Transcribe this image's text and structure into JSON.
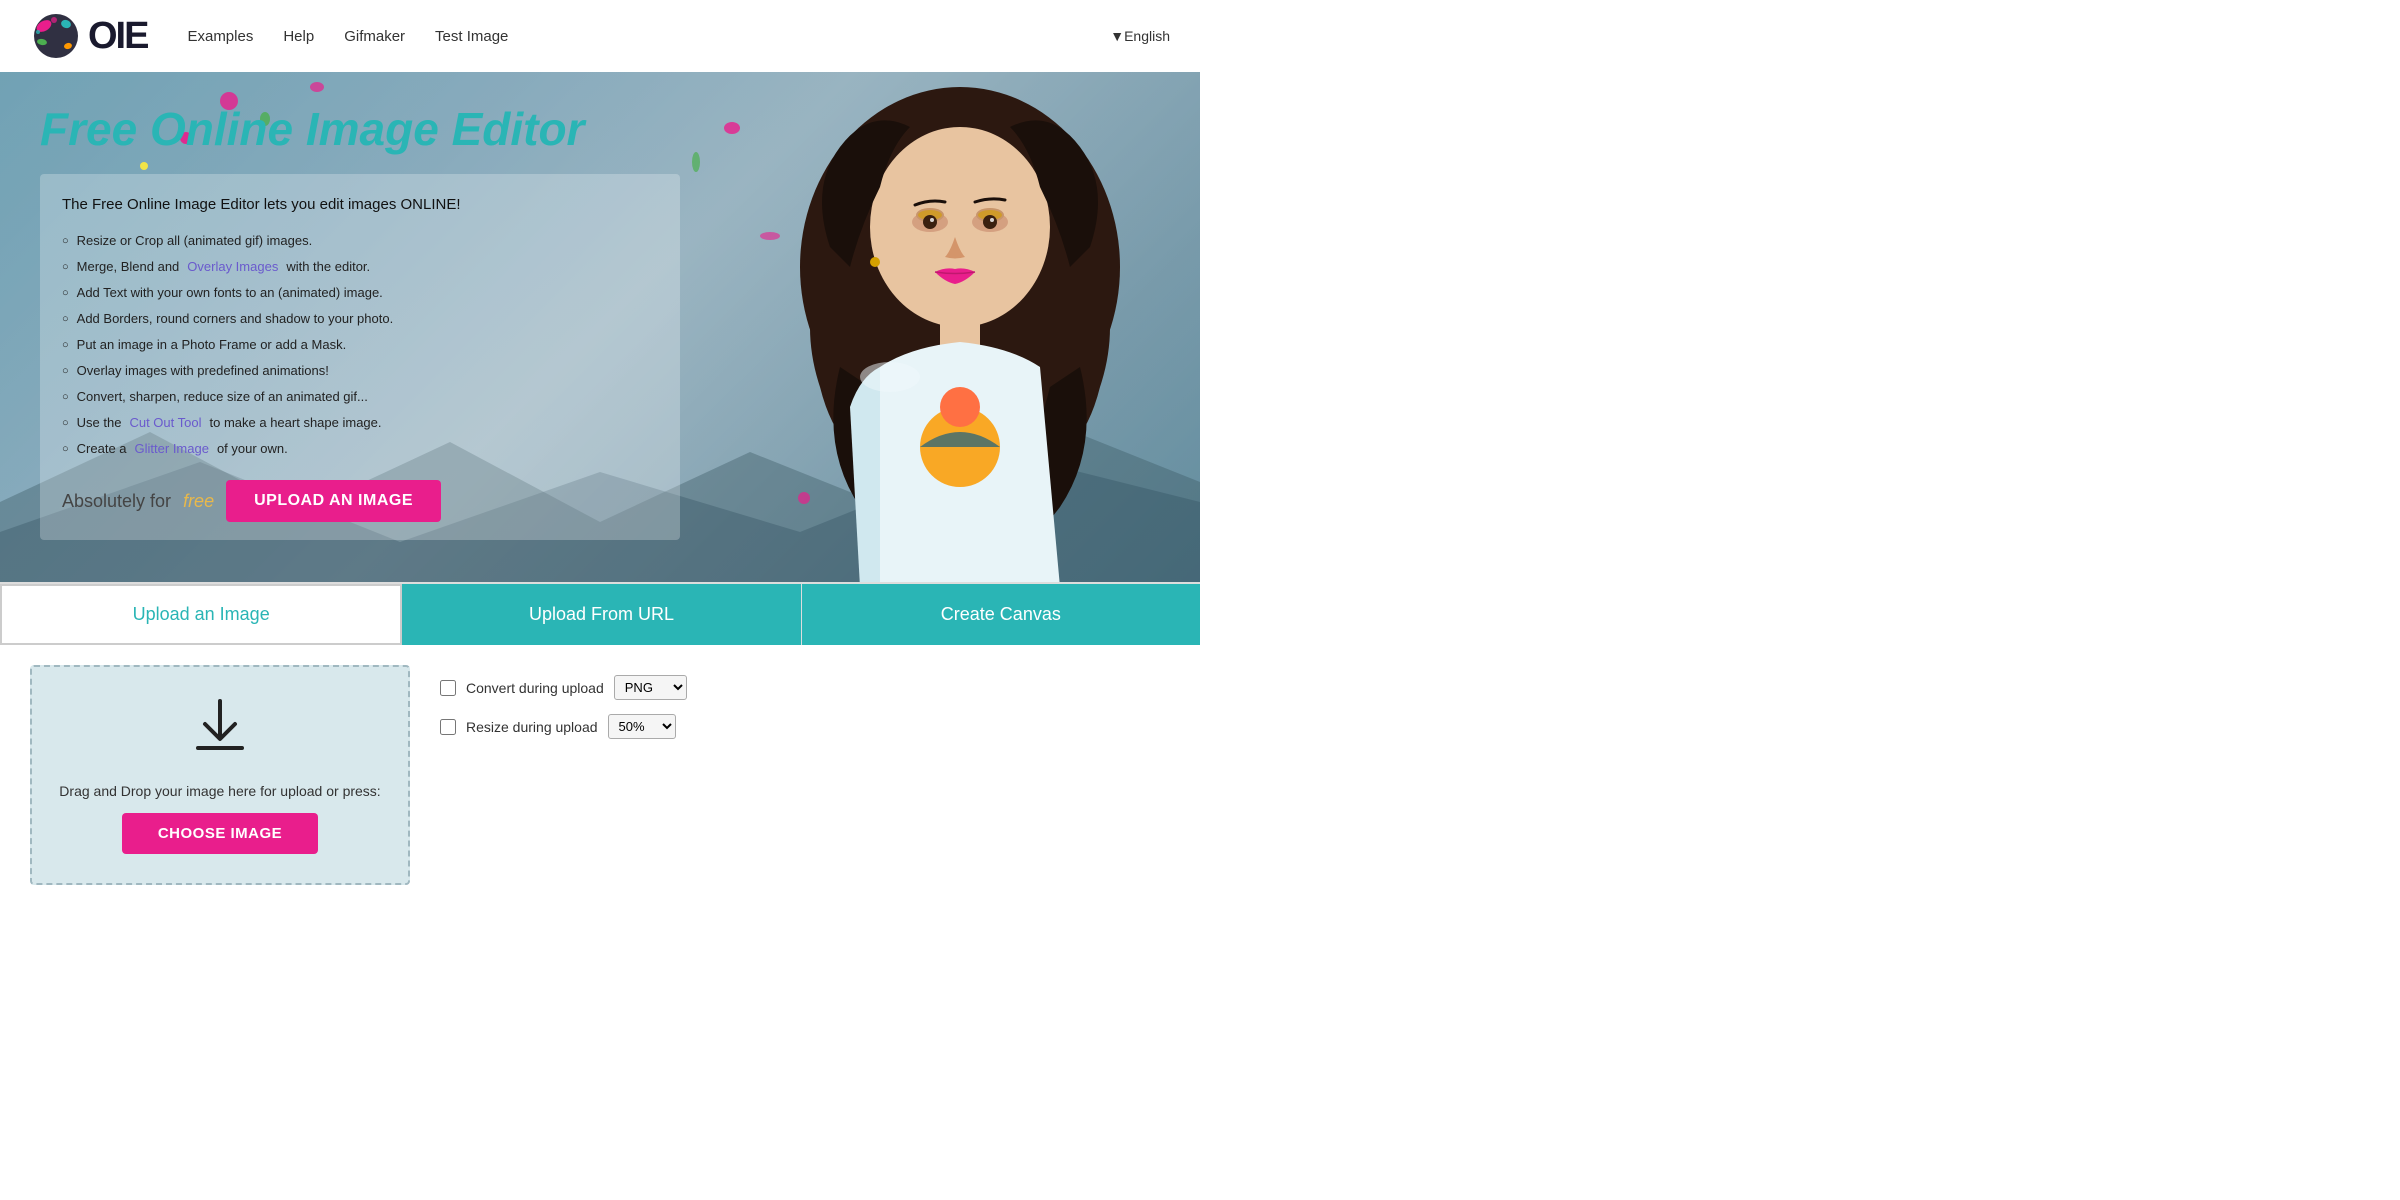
{
  "nav": {
    "logo_text": "OIE",
    "links": [
      {
        "label": "Examples",
        "name": "examples-link"
      },
      {
        "label": "Help",
        "name": "help-link"
      },
      {
        "label": "Gifmaker",
        "name": "gifmaker-link"
      },
      {
        "label": "Test Image",
        "name": "test-image-link"
      }
    ],
    "language": "▼English"
  },
  "hero": {
    "title": "Free Online Image Editor",
    "intro": "The Free Online Image Editor lets you edit images ONLINE!",
    "features": [
      "Resize or Crop all (animated gif) images.",
      "Merge, Blend and Overlay Images with the editor.",
      "Add Text with your own fonts to an (animated) image.",
      "Add Borders, round corners and shadow to your photo.",
      "Put an image in a Photo Frame or add a Mask.",
      "Overlay images with predefined animations!",
      "Convert, sharpen, reduce size of an animated gif...",
      "Use the Cut Out Tool to make a heart shape image.",
      "Create a Glitter Image of your own."
    ],
    "cta_text": "Absolutely for",
    "cta_free": "free",
    "upload_btn": "UPLOAD AN IMAGE"
  },
  "tabs": {
    "upload_image": "Upload an Image",
    "upload_url": "Upload From URL",
    "create_canvas": "Create Canvas"
  },
  "upload_panel": {
    "drag_text": "Drag and Drop your image here for upload or press:",
    "choose_btn": "CHOOSE IMAGE",
    "convert_label": "Convert during upload",
    "convert_value": "PNG ▼",
    "resize_label": "Resize during upload",
    "resize_value": "50% ▼"
  },
  "colors": {
    "teal": "#2ab5b5",
    "pink": "#e91e8c",
    "gold": "#e8b84b",
    "purple": "#6a5acd"
  }
}
